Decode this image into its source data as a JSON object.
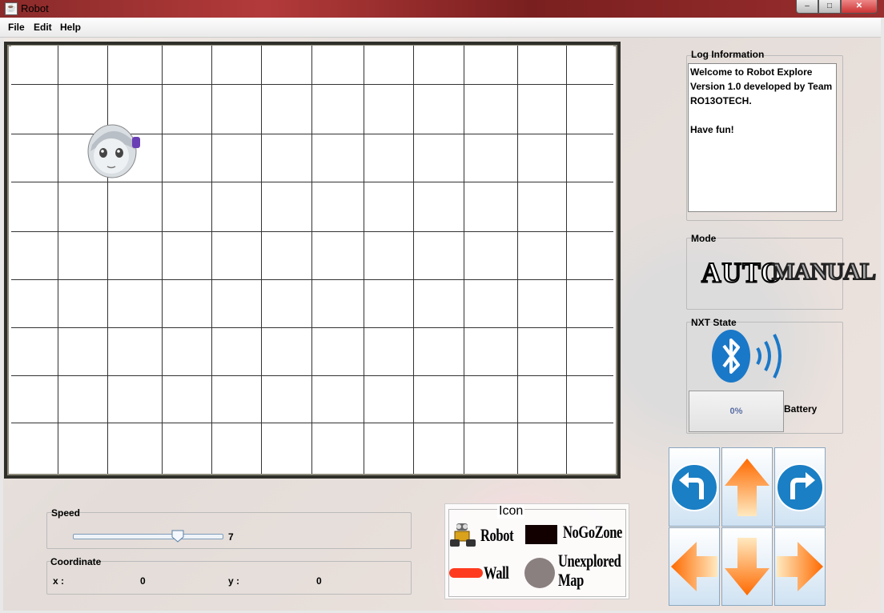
{
  "window": {
    "title": "Robot",
    "controls": {
      "minimize": "–",
      "maximize": "□",
      "close": "✕"
    }
  },
  "menu": {
    "file": "File",
    "edit": "Edit",
    "help": "Help"
  },
  "grid": {
    "columns": 12,
    "rows": 9,
    "robot_cell": {
      "col": 1,
      "row": 2
    }
  },
  "log": {
    "label": "Log Information",
    "text": "Welcome to Robot Explore\nVersion 1.0 developed by Team\nRO13OTECH.\n\nHave fun!"
  },
  "mode": {
    "label": "Mode",
    "auto": "AUTO",
    "manual": "MANUAL"
  },
  "nxt": {
    "label": "NXT State",
    "battery_value": "0%",
    "battery_label": "Battery",
    "bluetooth_icon": "bluetooth-icon"
  },
  "speed": {
    "label": "Speed",
    "value": "7",
    "max": 10,
    "level": 7
  },
  "coordinate": {
    "label": "Coordinate",
    "x_label": "x :",
    "x_value": "0",
    "y_label": "y :",
    "y_value": "0"
  },
  "icon_legend": {
    "title": "Icon",
    "robot": "Robot",
    "nogozone": "NoGoZone",
    "wall": "Wall",
    "unexplored_line1": "Unexplored",
    "unexplored_line2": "Map"
  },
  "colors": {
    "bluetooth": "#1a78c8",
    "arrow_orange": "#ff7a00",
    "turn_blue": "#1a7fc4",
    "wall": "#ff3b1f",
    "nogozone": "#120000",
    "unexplored": "#8a8080"
  }
}
